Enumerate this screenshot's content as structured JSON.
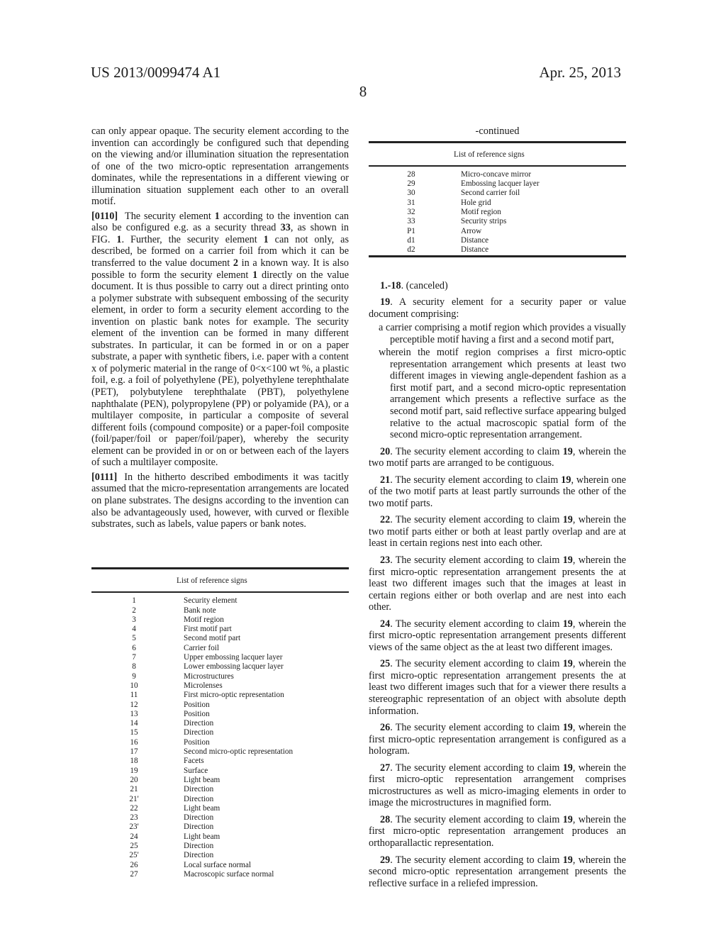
{
  "header": {
    "publication_number": "US 2013/0099474 A1",
    "date": "Apr. 25, 2013",
    "page_number": "8"
  },
  "left_column": {
    "para_continued": "can only appear opaque. The security element according to the invention can accordingly be configured such that depending on the viewing and/or illumination situation the representation of one of the two micro-optic representation arrangements dominates, while the representations in a different viewing or illumination situation supplement each other to an overall motif.",
    "para_0110": {
      "number": "[0110]",
      "segments": [
        {
          "t": "The security element ",
          "b": false
        },
        {
          "t": "1",
          "b": true
        },
        {
          "t": " according to the invention can also be configured e.g. as a security thread ",
          "b": false
        },
        {
          "t": "33",
          "b": true
        },
        {
          "t": ", as shown in FIG. ",
          "b": false
        },
        {
          "t": "1",
          "b": true
        },
        {
          "t": ". Further, the security element ",
          "b": false
        },
        {
          "t": "1",
          "b": true
        },
        {
          "t": " can not only, as described, be formed on a carrier foil from which it can be transferred to the value document ",
          "b": false
        },
        {
          "t": "2",
          "b": true
        },
        {
          "t": " in a known way. It is also possible to form the security element ",
          "b": false
        },
        {
          "t": "1",
          "b": true
        },
        {
          "t": " directly on the value document. It is thus possible to carry out a direct printing onto a polymer substrate with subsequent embossing of the security element, in order to form a security element according to the invention on plastic bank notes for example. The security element of the invention can be formed in many different substrates. In particular, it can be formed in or on a paper substrate, a paper with synthetic fibers, i.e. paper with a content x of polymeric material in the range of 0<x<100 wt %, a plastic foil, e.g. a foil of polyethylene (PE), polyethylene terephthalate (PET), polybutylene terephthalate (PBT), polyethylene naphthalate (PEN), polypropylene (PP) or polyamide (PA), or a multilayer composite, in particular a composite of several different foils (compound composite) or a paper-foil composite (foil/paper/foil or paper/foil/paper), whereby the security element can be provided in or on or between each of the layers of such a multilayer composite.",
          "b": false
        }
      ]
    },
    "para_0111": {
      "number": "[0111]",
      "text": "In the hitherto described embodiments it was tacitly assumed that the micro-representation arrangements are located on plane substrates. The designs according to the invention can also be advantageously used, however, with curved or flexible substrates, such as labels, value papers or bank notes."
    },
    "table": {
      "header": "List of reference signs",
      "rows": [
        {
          "num": "1",
          "desc": "Security element"
        },
        {
          "num": "2",
          "desc": "Bank note"
        },
        {
          "num": "3",
          "desc": "Motif region"
        },
        {
          "num": "4",
          "desc": "First motif part"
        },
        {
          "num": "5",
          "desc": "Second motif part"
        },
        {
          "num": "6",
          "desc": "Carrier foil"
        },
        {
          "num": "7",
          "desc": "Upper embossing lacquer layer"
        },
        {
          "num": "8",
          "desc": "Lower embossing lacquer layer"
        },
        {
          "num": "9",
          "desc": "Microstructures"
        },
        {
          "num": "10",
          "desc": "Microlenses"
        },
        {
          "num": "11",
          "desc": "First micro-optic representation"
        },
        {
          "num": "12",
          "desc": "Position"
        },
        {
          "num": "13",
          "desc": "Position"
        },
        {
          "num": "14",
          "desc": "Direction"
        },
        {
          "num": "15",
          "desc": "Direction"
        },
        {
          "num": "16",
          "desc": "Position"
        },
        {
          "num": "17",
          "desc": "Second micro-optic representation"
        },
        {
          "num": "18",
          "desc": "Facets"
        },
        {
          "num": "19",
          "desc": "Surface"
        },
        {
          "num": "20",
          "desc": "Light beam"
        },
        {
          "num": "21",
          "desc": "Direction"
        },
        {
          "num": "21'",
          "desc": "Direction"
        },
        {
          "num": "22",
          "desc": "Light beam"
        },
        {
          "num": "23",
          "desc": "Direction"
        },
        {
          "num": "23'",
          "desc": "Direction"
        },
        {
          "num": "24",
          "desc": "Light beam"
        },
        {
          "num": "25",
          "desc": "Direction"
        },
        {
          "num": "25'",
          "desc": "Direction"
        },
        {
          "num": "26",
          "desc": "Local surface normal"
        },
        {
          "num": "27",
          "desc": "Macroscopic surface normal"
        }
      ]
    }
  },
  "right_column": {
    "table": {
      "continued_label": "-continued",
      "header": "List of reference signs",
      "rows": [
        {
          "num": "28",
          "desc": "Micro-concave mirror"
        },
        {
          "num": "29",
          "desc": "Embossing lacquer layer"
        },
        {
          "num": "30",
          "desc": "Second carrier foil"
        },
        {
          "num": "31",
          "desc": "Hole grid"
        },
        {
          "num": "32",
          "desc": "Motif region"
        },
        {
          "num": "33",
          "desc": "Security strips"
        },
        {
          "num": "P1",
          "desc": "Arrow"
        },
        {
          "num": "d1",
          "desc": "Distance"
        },
        {
          "num": "d2",
          "desc": "Distance"
        }
      ]
    },
    "claims": {
      "canceled": {
        "number": "1.-18",
        "text": ". (canceled)"
      },
      "claim_19": {
        "number": "19",
        "intro": ". A security element for a security paper or value document comprising:",
        "items": [
          "a carrier comprising a motif region which provides a visually perceptible motif having a first and a second motif part,",
          "wherein the motif region comprises a first micro-optic representation arrangement which presents at least two different images in viewing angle-dependent fashion as a first motif part, and a second micro-optic representation arrangement which presents a reflective surface as the second motif part, said reflective surface appearing bulged relative to the actual macroscopic spatial form of the second micro-optic representation arrangement."
        ]
      },
      "dependent": [
        {
          "number": "20",
          "ref": "19",
          "pre": ". The security element according to claim ",
          "post": ", wherein the two motif parts are arranged to be contiguous."
        },
        {
          "number": "21",
          "ref": "19",
          "pre": ". The security element according to claim ",
          "post": ", wherein one of the two motif parts at least partly surrounds the other of the two motif parts."
        },
        {
          "number": "22",
          "ref": "19",
          "pre": ". The security element according to claim ",
          "post": ", wherein the two motif parts either or both at least partly overlap and are at least in certain regions nest into each other."
        },
        {
          "number": "23",
          "ref": "19",
          "pre": ". The security element according to claim ",
          "post": ", wherein the first micro-optic representation arrangement presents the at least two different images such that the images at least in certain regions either or both overlap and are nest into each other."
        },
        {
          "number": "24",
          "ref": "19",
          "pre": ". The security element according to claim ",
          "post": ", wherein the first micro-optic representation arrangement presents different views of the same object as the at least two different images."
        },
        {
          "number": "25",
          "ref": "19",
          "pre": ". The security element according to claim ",
          "post": ", wherein the first micro-optic representation arrangement presents the at least two different images such that for a viewer there results a stereographic representation of an object with absolute depth information."
        },
        {
          "number": "26",
          "ref": "19",
          "pre": ". The security element according to claim ",
          "post": ", wherein the first micro-optic representation arrangement is configured as a hologram."
        },
        {
          "number": "27",
          "ref": "19",
          "pre": ". The security element according to claim ",
          "post": ", wherein the first micro-optic representation arrangement comprises microstructures as well as micro-imaging elements in order to image the microstructures in magnified form."
        },
        {
          "number": "28",
          "ref": "19",
          "pre": ". The security element according to claim ",
          "post": ", wherein the first micro-optic representation arrangement produces an orthoparallactic representation."
        },
        {
          "number": "29",
          "ref": "19",
          "pre": ". The security element according to claim ",
          "post": ", wherein the second micro-optic representation arrangement presents the reflective surface in a reliefed impression."
        }
      ]
    }
  }
}
